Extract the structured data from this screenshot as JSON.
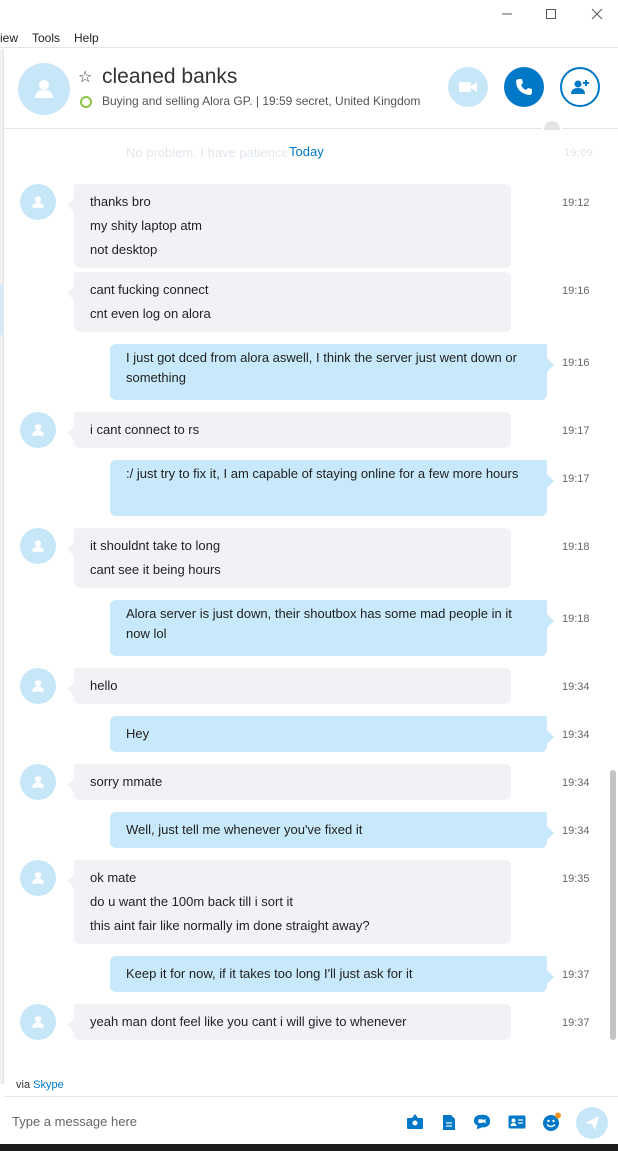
{
  "menu": {
    "view": "iew",
    "tools": "Tools",
    "help": "Help"
  },
  "header": {
    "contact_name": "cleaned banks",
    "mood": "Buying and selling Alora GP.  |  19:59 secret, United Kingdom"
  },
  "conversation": {
    "faded_message": "No problem, I have patience",
    "faded_time": "19:09",
    "date_divider": "Today",
    "messages": [
      {
        "dir": "in",
        "lines": [
          "thanks bro",
          "my shity laptop atm",
          "not desktop"
        ],
        "time": "19:12"
      },
      {
        "dir": "in",
        "lines": [
          "cant fucking connect",
          "cnt even log on alora"
        ],
        "time": "19:16"
      },
      {
        "dir": "out",
        "lines": [
          "I just got dced from alora aswell, I think the server just went down or something"
        ],
        "time": "19:16"
      },
      {
        "dir": "in",
        "lines": [
          "i cant connect to rs"
        ],
        "time": "19:17"
      },
      {
        "dir": "out",
        "lines": [
          ":/ just try to fix it, I am capable of staying online for a few more hours"
        ],
        "time": "19:17"
      },
      {
        "dir": "in",
        "lines": [
          "it shouldnt take to long",
          "cant see it being hours"
        ],
        "time": "19:18"
      },
      {
        "dir": "out",
        "lines": [
          "Alora server is just down, their shoutbox has some mad people in it now lol"
        ],
        "time": "19:18"
      },
      {
        "dir": "in",
        "lines": [
          "hello"
        ],
        "time": "19:34"
      },
      {
        "dir": "out",
        "lines": [
          "Hey"
        ],
        "time": "19:34"
      },
      {
        "dir": "in",
        "lines": [
          "sorry mmate"
        ],
        "time": "19:34"
      },
      {
        "dir": "out",
        "lines": [
          "Well, just tell me whenever you've fixed it"
        ],
        "time": "19:34"
      },
      {
        "dir": "in",
        "lines": [
          "ok mate",
          "do u want the 100m back till i sort it",
          "this aint fair like normally im done straight away?"
        ],
        "time": "19:35"
      },
      {
        "dir": "out",
        "lines": [
          "Keep it for now, if it takes too long I'll just ask for it"
        ],
        "time": "19:37"
      },
      {
        "dir": "in",
        "lines": [
          "yeah man dont feel like you cant i will give to whenever"
        ],
        "time": "19:37"
      }
    ]
  },
  "footer": {
    "via_prefix": "via",
    "via_link": "Skype",
    "input_placeholder": "Type a message here"
  },
  "icons": {
    "video": "video-camera-icon",
    "call": "phone-icon",
    "add_people": "add-person-icon",
    "tools": [
      "media-gallery-icon",
      "file-icon",
      "video-message-icon",
      "contact-card-icon",
      "emoticon-icon"
    ],
    "send": "send-icon"
  },
  "colors": {
    "accent": "#0078c8",
    "outgoing_bubble": "#c7e9fb",
    "incoming_bubble": "#f1f2f6",
    "avatar": "#c7e6f8",
    "presence": "#8cc63f"
  }
}
